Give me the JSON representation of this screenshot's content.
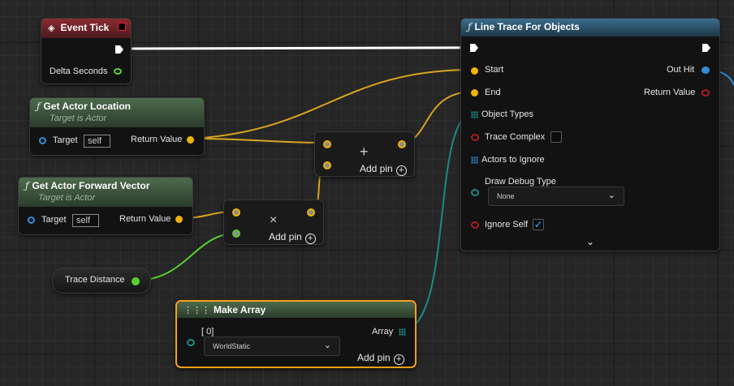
{
  "nodes": {
    "event_tick": {
      "title": "Event Tick",
      "delta_seconds": "Delta Seconds"
    },
    "get_actor_location": {
      "title": "Get Actor Location",
      "subtitle": "Target is Actor",
      "target_label": "Target",
      "target_value": "self",
      "return_label": "Return Value"
    },
    "get_actor_forward_vector": {
      "title": "Get Actor Forward Vector",
      "subtitle": "Target is Actor",
      "target_label": "Target",
      "target_value": "self",
      "return_label": "Return Value"
    },
    "add_node": {
      "symbol": "+",
      "add_pin": "Add pin"
    },
    "multiply_node": {
      "symbol": "×",
      "add_pin": "Add pin"
    },
    "trace_distance": {
      "label": "Trace Distance"
    },
    "line_trace": {
      "title": "Line Trace For Objects",
      "start": "Start",
      "end": "End",
      "object_types": "Object Types",
      "trace_complex": "Trace Complex",
      "actors_to_ignore": "Actors to Ignore",
      "draw_debug_type": "Draw Debug Type",
      "draw_debug_value": "None",
      "ignore_self": "Ignore Self",
      "ignore_self_checked": true,
      "out_hit": "Out Hit",
      "return_value": "Return Value"
    },
    "make_array": {
      "title": "Make Array",
      "index_label": "[ 0]",
      "index_value": "WorldStatic",
      "array_label": "Array",
      "add_pin": "Add pin"
    }
  },
  "colors": {
    "exec": "#ffffff",
    "vector": "#f0b400",
    "float": "#58d030",
    "object": "#2f8fd8",
    "bool": "#a81c1c",
    "enum": "#1a8c82",
    "selected": "#f7a01a"
  }
}
